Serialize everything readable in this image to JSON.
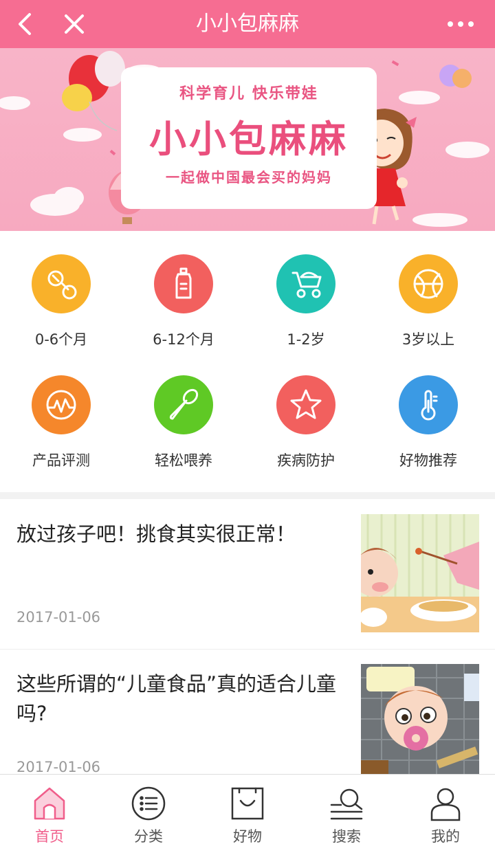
{
  "header": {
    "title": "小小包麻麻",
    "back_icon": "back-chevron-icon",
    "close_icon": "close-icon",
    "more_icon": "more-dots-icon",
    "background_color": "#f66d92"
  },
  "banner": {
    "slogan_top": "科学育儿  快乐带娃",
    "brand": "小小包麻麻",
    "slogan_bottom": "一起做中国最会买的妈妈"
  },
  "categories": [
    {
      "label": "0-6个月",
      "icon": "pacifier-icon",
      "color": "#f9b12a"
    },
    {
      "label": "6-12个月",
      "icon": "baby-bottle-icon",
      "color": "#f2605e"
    },
    {
      "label": "1-2岁",
      "icon": "stroller-icon",
      "color": "#20c2b2"
    },
    {
      "label": "3岁以上",
      "icon": "ball-icon",
      "color": "#f9b12a"
    },
    {
      "label": "产品评测",
      "icon": "chart-wave-icon",
      "color": "#f5872b"
    },
    {
      "label": "轻松喂养",
      "icon": "spoon-icon",
      "color": "#5fc925"
    },
    {
      "label": "疾病防护",
      "icon": "star-icon",
      "color": "#f2605e"
    },
    {
      "label": "好物推荐",
      "icon": "thermometer-icon",
      "color": "#3b9ae4"
    }
  ],
  "articles": [
    {
      "title": "放过孩子吧！挑食其实很正常！",
      "date": "2017-01-06"
    },
    {
      "title": "这些所谓的“儿童食品”真的适合儿童吗?",
      "date": "2017-01-06"
    }
  ],
  "tabs": [
    {
      "label": "首页",
      "icon": "home-icon",
      "active": true
    },
    {
      "label": "分类",
      "icon": "list-circle-icon",
      "active": false
    },
    {
      "label": "好物",
      "icon": "shopping-bag-icon",
      "active": false
    },
    {
      "label": "搜索",
      "icon": "search-icon",
      "active": false
    },
    {
      "label": "我的",
      "icon": "user-icon",
      "active": false
    }
  ],
  "accent_color": "#f05d8a"
}
